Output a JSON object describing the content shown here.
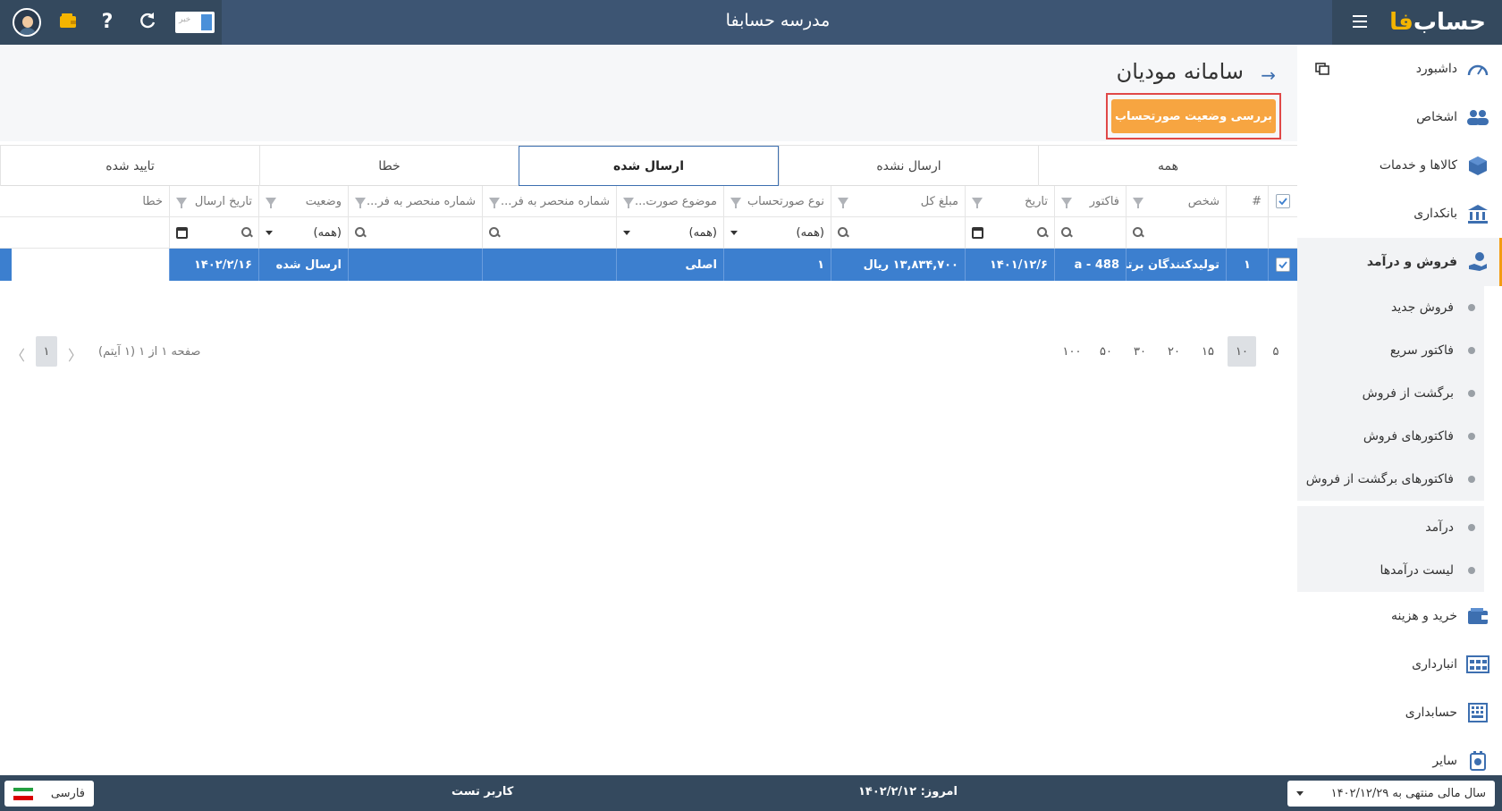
{
  "app": {
    "logo_text_main": "حساب",
    "logo_text_accent": "فا",
    "title": "مدرسه حسابفا",
    "news_label": "خبر"
  },
  "sidebar": {
    "items": [
      {
        "label": "داشبورد",
        "icon": "dashboard-gauge-icon"
      },
      {
        "label": "اشخاص",
        "icon": "people-icon"
      },
      {
        "label": "کالاها و خدمات",
        "icon": "box-icon"
      },
      {
        "label": "بانکداری",
        "icon": "bank-icon"
      },
      {
        "label": "فروش و درآمد",
        "icon": "sales-hand-icon"
      }
    ],
    "sales_sub": [
      {
        "label": "فروش جدید"
      },
      {
        "label": "فاکتور سریع"
      },
      {
        "label": "برگشت از فروش"
      },
      {
        "label": "فاکتورهای فروش"
      },
      {
        "label": "فاکتورهای برگشت از فروش"
      }
    ],
    "income_sub": [
      {
        "label": "درآمد"
      },
      {
        "label": "لیست درآمدها"
      }
    ],
    "bottom_items": [
      {
        "label": "خرید و هزینه",
        "icon": "wallet-icon"
      },
      {
        "label": "انبارداری",
        "icon": "warehouse-icon"
      },
      {
        "label": "حسابداری",
        "icon": "calculator-icon"
      },
      {
        "label": "سایر",
        "icon": "settings-icon"
      }
    ]
  },
  "page": {
    "title": "سامانه مودیان",
    "check_status_button": "بررسی وضعیت صورتحساب"
  },
  "tabs": [
    "همه",
    "ارسال نشده",
    "ارسال شده",
    "خطا",
    "تایید شده"
  ],
  "active_tab_index": 2,
  "grid": {
    "columns": [
      "#",
      "شخص",
      "فاکتور",
      "تاریخ",
      "مبلغ کل",
      "نوع صورتحساب",
      "موضوع صورت...",
      "شماره منحصر به فر...",
      "شماره منحصر به فر...",
      "وضعیت",
      "تاریخ ارسال",
      "خطا"
    ],
    "filter_all": "(همه)",
    "rows": [
      {
        "index": "۱",
        "person": "تولیدکنندگان برتر - مه",
        "invoice": "488 - a",
        "date": "۱۴۰۱/۱۲/۶",
        "total": "۱۳,۸۳۴,۷۰۰ ریال",
        "invoice_type": "۱",
        "subject": "اصلی",
        "unique_no_1": "",
        "unique_no_2": "",
        "status": "ارسال شده",
        "send_date": "۱۴۰۲/۲/۱۶",
        "error": ""
      }
    ]
  },
  "pager": {
    "sizes": [
      "۵",
      "۱۰",
      "۱۵",
      "۲۰",
      "۳۰",
      "۵۰",
      "۱۰۰"
    ],
    "active_size": "۱۰",
    "info": "صفحه ۱ از ۱ (۱ آیتم)",
    "current_page": "۱"
  },
  "footer": {
    "fiscal_year": "سال مالی منتهی به ۱۴۰۲/۱۲/۲۹",
    "today": "امروز: ۱۴۰۲/۲/۱۲",
    "user": "کاربر تست",
    "language": "فارسی"
  },
  "colors": {
    "topbar": "#3d5573",
    "accent_orange": "#f7a541",
    "selected_row": "#3c7fcf",
    "footer": "#34495e"
  }
}
